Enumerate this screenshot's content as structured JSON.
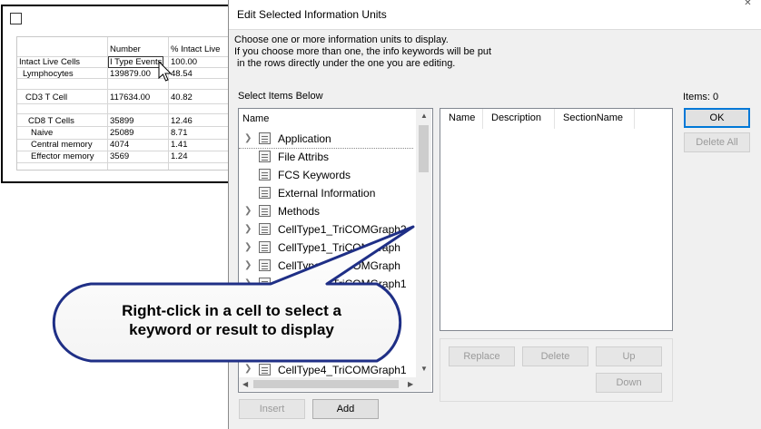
{
  "background_table": {
    "headers": [
      "Number",
      "% Intact Live"
    ],
    "rows": [
      {
        "name": "Intact Live Cells",
        "number": "I Type Events",
        "pct": "100.00"
      },
      {
        "name": "Lymphocytes",
        "number": "139879.00",
        "pct": "48.54"
      },
      {
        "name": "CD3 T Cell",
        "number": "117634.00",
        "pct": "40.82"
      },
      {
        "name": "CD8 T Cells",
        "number": "35899",
        "pct": "12.46"
      },
      {
        "name": "Naive",
        "number": "25089",
        "pct": "8.71"
      },
      {
        "name": "Central memory",
        "number": "4074",
        "pct": "1.41"
      },
      {
        "name": "Effector memory",
        "number": "3569",
        "pct": "1.24"
      }
    ]
  },
  "dialog": {
    "title": "Edit Selected Information Units",
    "close_glyph": "✕",
    "instructions": [
      "Choose one or more information units to display.",
      "If you choose more than one, the info keywords will be put",
      " in the rows directly under the one you are editing."
    ],
    "select_label": "Select Items Below",
    "items_label": "Items: 0",
    "tree": {
      "header": "Name",
      "items": [
        {
          "label": "Application",
          "expandable": true,
          "icon": "list-icon"
        },
        {
          "label": "File Attribs",
          "expandable": false,
          "icon": "list-icon"
        },
        {
          "label": "FCS Keywords",
          "expandable": false,
          "icon": "list-icon"
        },
        {
          "label": "External Information",
          "expandable": false,
          "icon": "list-icon"
        },
        {
          "label": "Methods",
          "expandable": true,
          "icon": "list-icon"
        },
        {
          "label": "CellType1_TriCOMGraph2",
          "expandable": true,
          "icon": "list-icon"
        },
        {
          "label": "CellType1_TriCOMGraph",
          "expandable": true,
          "icon": "list-icon"
        },
        {
          "label": "CellType2_TriCOMGraph",
          "expandable": true,
          "icon": "list-icon"
        },
        {
          "label": "CellType3_TriCOMGraph1",
          "expandable": true,
          "icon": "list-icon"
        },
        {
          "label": "CellType4_TriCOMGraph1",
          "expandable": true,
          "icon": "list-icon"
        }
      ]
    },
    "selected_columns": [
      "Name",
      "Description",
      "SectionName"
    ],
    "buttons": {
      "ok": "OK",
      "delete_all": "Delete All",
      "replace": "Replace",
      "delete": "Delete",
      "up": "Up",
      "down": "Down",
      "insert": "Insert",
      "add": "Add"
    }
  },
  "callout": {
    "line1": "Right-click in a cell to select a",
    "line2": "keyword or result to display"
  }
}
